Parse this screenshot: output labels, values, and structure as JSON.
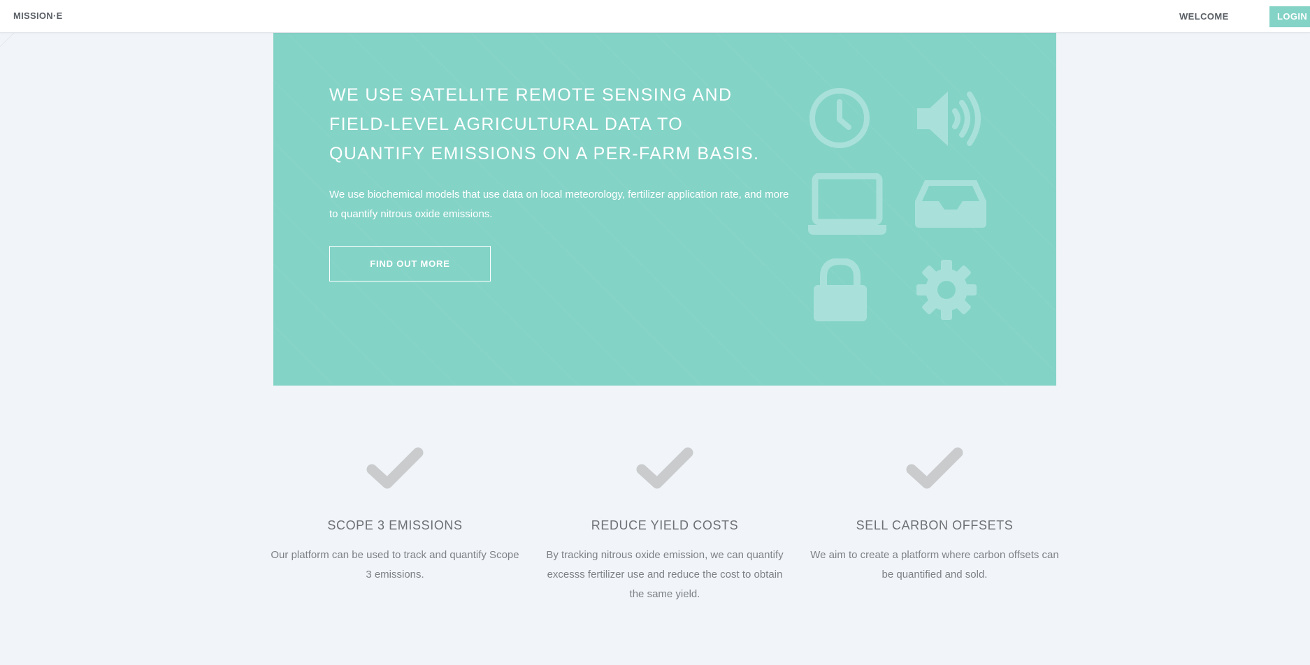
{
  "nav": {
    "brand": "MISSION·E",
    "welcome": "WELCOME",
    "login": "LOGIN"
  },
  "hero": {
    "title": "WE USE SATELLITE REMOTE SENSING AND FIELD-LEVEL AGRICULTURAL DATA TO QUANTIFY EMISSIONS ON A PER-FARM BASIS.",
    "text": "We use biochemical models that use data on local meteorology, fertilizer application rate, and more to quantify nitrous oxide emissions.",
    "button": "FIND OUT MORE",
    "icons": [
      "clock-icon",
      "speaker-icon",
      "laptop-icon",
      "inbox-icon",
      "lock-icon",
      "gear-icon"
    ]
  },
  "features": [
    {
      "icon": "checkmark-icon",
      "title": "SCOPE 3 EMISSIONS",
      "text": "Our platform can be used to track and quantify Scope 3 emissions."
    },
    {
      "icon": "checkmark-icon",
      "title": "REDUCE YIELD COSTS",
      "text": "By tracking nitrous oxide emission, we can quantify excesss fertilizer use and reduce the cost to obtain the same yield."
    },
    {
      "icon": "checkmark-icon",
      "title": "SELL CARBON OFFSETS",
      "text": "We aim to create a platform where carbon offsets can be quantified and sold."
    }
  ],
  "colors": {
    "accent": "#84d3c7",
    "background": "#f1f4f8",
    "icon_tint": "#a9e1da",
    "check": "#c9cbcd"
  }
}
